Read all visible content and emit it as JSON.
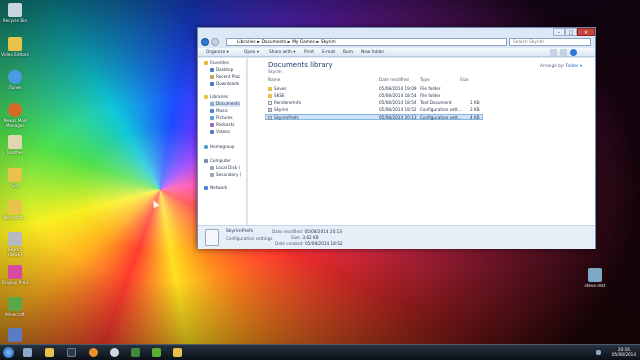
{
  "desktop": {
    "icons": [
      {
        "label": "Recycle Bin",
        "color": "#c8d4e0"
      },
      {
        "label": "Video Editors",
        "color": "#e8c24a"
      },
      {
        "label": "iTunes",
        "color": "#4a9be0"
      },
      {
        "label": "Nexus Mod Manager",
        "color": "#d86a28"
      },
      {
        "label": "heather",
        "color": "#e0d7b0"
      },
      {
        "label": "Gifs",
        "color": "#e8c24a"
      },
      {
        "label": "Microsoft...",
        "color": "#e8c24a"
      },
      {
        "label": "Skyrim (SKSE)",
        "color": "#b6b9c0"
      },
      {
        "label": "Display Prod",
        "color": "#d84aa0"
      },
      {
        "label": "Minecraft",
        "color": "#5aa648"
      },
      {
        "label": "",
        "color": "#5b7cc4"
      }
    ],
    "right_icon_label": "steve.mkt"
  },
  "window": {
    "address": {
      "parts": [
        "Libraries",
        "Documents",
        "My Games",
        "Skyrim"
      ],
      "separator": "►"
    },
    "search_placeholder": "Search Skyrim",
    "toolbar": {
      "organize": "Organize ▾",
      "open": "Open ▾",
      "share_with": "Share with ▾",
      "print": "Print",
      "email": "E-mail",
      "burn": "Burn",
      "new_folder": "New folder"
    },
    "nav": {
      "favorites": "Favorites",
      "desktop": "Desktop",
      "recent_places": "Recent Plac",
      "downloads": "Downloads",
      "libraries": "Libraries",
      "documents": "Documents",
      "music": "Music",
      "pictures": "Pictures",
      "podcasts": "Podcasts",
      "videos": "Videos",
      "homegroup": "Homegroup",
      "computer": "Computer",
      "local_disk": "Local Disk (",
      "secondary": "Secondary (",
      "network": "Network"
    },
    "library_title": "Documents library",
    "library_subtitle": "Skyrim",
    "arrange_by_label": "Arrange by:",
    "arrange_by_value": "Folder ▾",
    "columns": {
      "name": "Name",
      "date": "Date modified",
      "type": "Type",
      "size": "Size"
    },
    "files": [
      {
        "name": "Saves",
        "date": "05/08/2014 19:09",
        "type": "File folder",
        "size": "",
        "kind": "folder"
      },
      {
        "name": "SKSE",
        "date": "05/08/2014 18:54",
        "type": "File folder",
        "size": "",
        "kind": "folder"
      },
      {
        "name": "RendererInfo",
        "date": "05/08/2014 18:54",
        "type": "Text Document",
        "size": "1 KB",
        "kind": "text"
      },
      {
        "name": "Skyrim",
        "date": "05/08/2014 18:52",
        "type": "Configuration sett...",
        "size": "2 KB",
        "kind": "config"
      },
      {
        "name": "SkyrimPrefs",
        "date": "05/08/2014 20:13",
        "type": "Configuration sett...",
        "size": "4 KB",
        "kind": "config"
      }
    ],
    "details": {
      "name": "SkyrimPrefs",
      "kind": "Configuration settings",
      "modified_label": "Date modified:",
      "modified": "05/08/2014 20:13",
      "size_label": "Size:",
      "size": "3.62 KB",
      "created_label": "Date created:",
      "created": "05/08/2014 18:52"
    }
  },
  "taskbar": {
    "clock_time": "20:16",
    "clock_date": "05/08/2014"
  }
}
